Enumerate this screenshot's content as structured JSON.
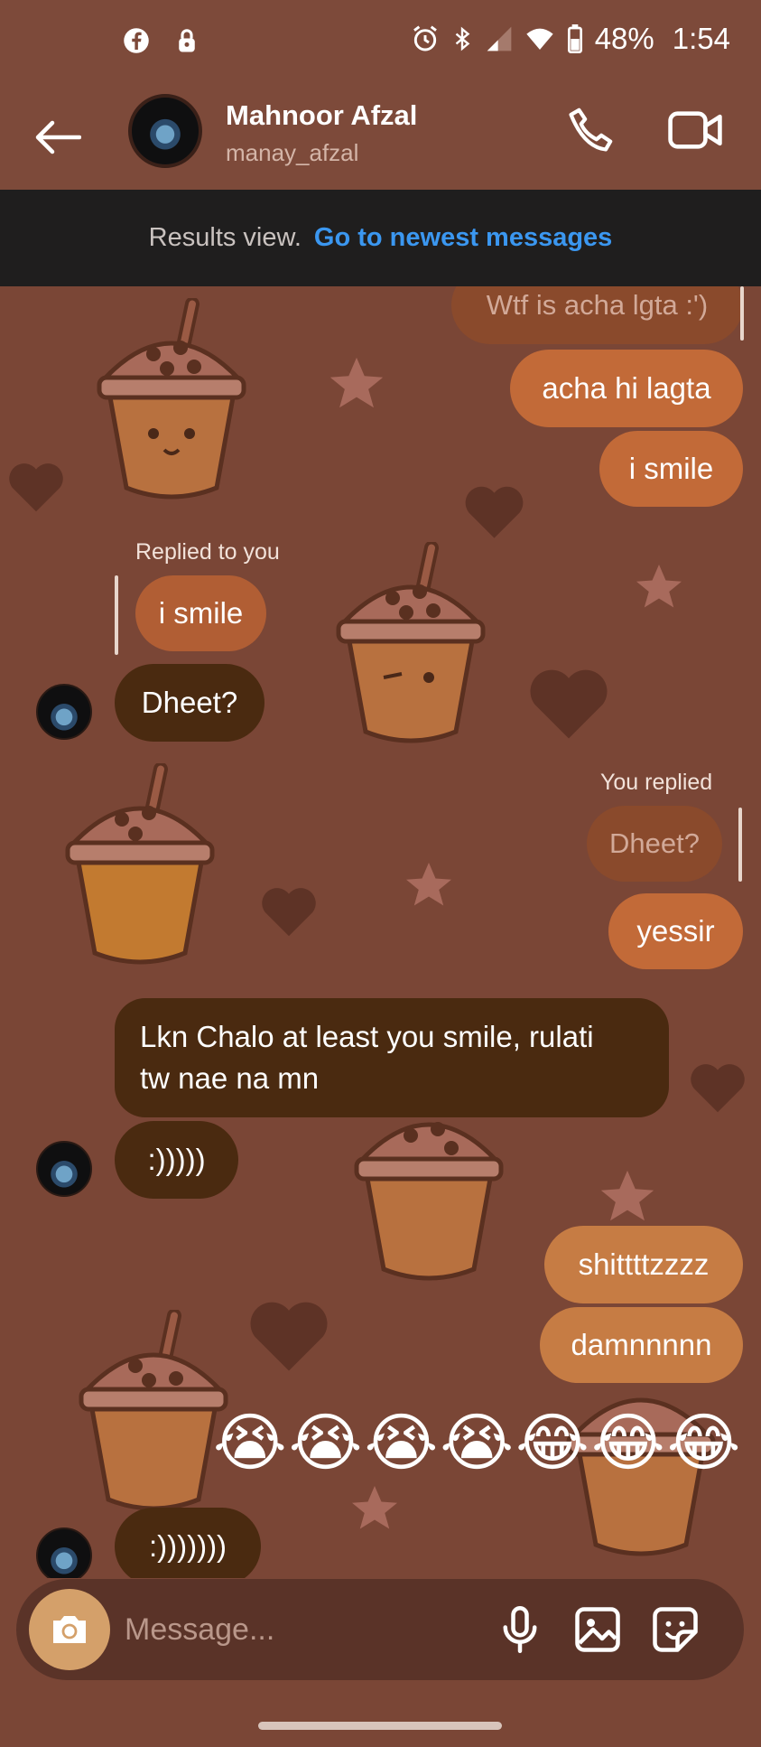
{
  "status_bar": {
    "battery": "48%",
    "time": "1:54"
  },
  "header": {
    "contact_name": "Mahnoor Afzal",
    "contact_handle": "manay_afzal"
  },
  "banner": {
    "text": "Results view.",
    "link": "Go to newest messages"
  },
  "messages": {
    "m0": "Wtf is acha lgta :')",
    "m1": "acha hi lagta",
    "m2": "i smile",
    "reply_label_1": "Replied to you",
    "quote_1": "i smile",
    "m3": "Dheet?",
    "reply_label_2": "You replied",
    "quote_2": "Dheet?",
    "m4": "yessir",
    "m5_line1": "Lkn Chalo at least you smile, rulati",
    "m5_line2": "tw nae na mn",
    "m6": ":)))))",
    "m7": "shittttzzzz",
    "m8": "damnnnnn",
    "m9": "😭😭😭😭😂😂😂",
    "m10": ":)))))))"
  },
  "composer": {
    "placeholder": "Message..."
  },
  "colors": {
    "background": "#7a4636",
    "outgoing_bubble": "#c26a38",
    "incoming_bubble": "#4a2a10",
    "link": "#3b97f0",
    "banner": "#1f1e1e"
  }
}
